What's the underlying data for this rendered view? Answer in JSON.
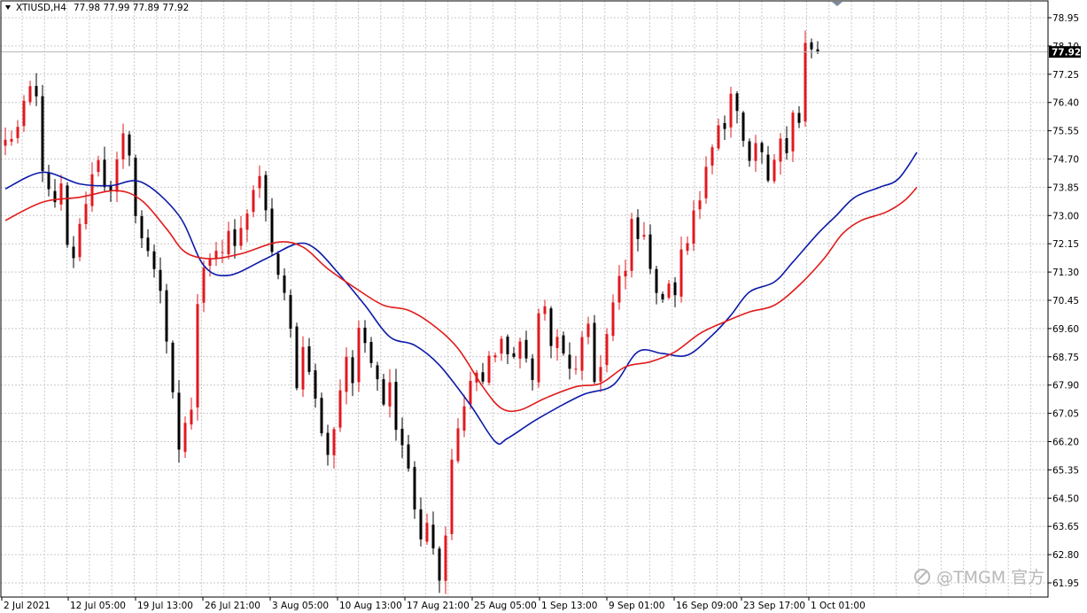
{
  "header": {
    "symbol": "XTIUSD,H4",
    "ohlc": "77.98 77.99 77.89 77.92"
  },
  "watermark": "@TMGM 官方",
  "current_price": "77.92",
  "colors": {
    "bull": "#e0191f",
    "bear": "#000000",
    "ma_fast": "#0c1aa8",
    "ma_slow": "#e01b1b",
    "grid": "#c9c9c9",
    "price_label_bg": "#000000"
  },
  "chart_data": {
    "type": "candlestick",
    "title": "",
    "xlabel": "",
    "ylabel": "",
    "ylim": [
      61.6,
      79.3
    ],
    "y_ticks": [
      "78.95",
      "78.10",
      "77.25",
      "76.40",
      "75.55",
      "74.70",
      "73.85",
      "73.00",
      "72.15",
      "71.30",
      "70.45",
      "69.60",
      "68.75",
      "67.90",
      "67.05",
      "66.20",
      "65.35",
      "64.50",
      "63.65",
      "62.80",
      "61.95"
    ],
    "x_ticks": [
      "2 Jul 2021",
      "12 Jul 05:00",
      "19 Jul 13:00",
      "26 Jul 21:00",
      "3 Aug 05:00",
      "10 Aug 13:00",
      "17 Aug 21:00",
      "25 Aug 05:00",
      "1 Sep 13:00",
      "9 Sep 01:00",
      "16 Sep 09:00",
      "23 Sep 17:00",
      "1 Oct 01:00"
    ],
    "grid": true,
    "close_path": [
      [
        0,
        75.2
      ],
      [
        2,
        75.6
      ],
      [
        4,
        76.8
      ],
      [
        5,
        76.5
      ],
      [
        6,
        74.5
      ],
      [
        7,
        73.6
      ],
      [
        8,
        73.3
      ],
      [
        9,
        73.8
      ],
      [
        10,
        72.0
      ],
      [
        11,
        71.8
      ],
      [
        12,
        72.6
      ],
      [
        13,
        73.5
      ],
      [
        14,
        74.2
      ],
      [
        15,
        74.8
      ],
      [
        16,
        74.0
      ],
      [
        17,
        73.6
      ],
      [
        18,
        74.5
      ],
      [
        19,
        75.3
      ],
      [
        20,
        75.0
      ],
      [
        21,
        73.0
      ],
      [
        22,
        72.2
      ],
      [
        23,
        72.0
      ],
      [
        24,
        71.5
      ],
      [
        25,
        70.8
      ],
      [
        26,
        69.0
      ],
      [
        27,
        67.5
      ],
      [
        28,
        66.0
      ],
      [
        29,
        66.8
      ],
      [
        30,
        67.0
      ],
      [
        31,
        70.5
      ],
      [
        32,
        71.6
      ],
      [
        33,
        71.8
      ],
      [
        34,
        72.0
      ],
      [
        35,
        71.9
      ],
      [
        36,
        72.3
      ],
      [
        37,
        72.1
      ],
      [
        38,
        72.5
      ],
      [
        39,
        73.2
      ],
      [
        40,
        73.8
      ],
      [
        41,
        74.0
      ],
      [
        42,
        73.0
      ],
      [
        43,
        72.0
      ],
      [
        44,
        71.2
      ],
      [
        45,
        70.5
      ],
      [
        46,
        69.5
      ],
      [
        47,
        68.0
      ],
      [
        48,
        69.0
      ],
      [
        49,
        68.5
      ],
      [
        50,
        67.4
      ],
      [
        51,
        66.5
      ],
      [
        52,
        65.7
      ],
      [
        53,
        66.7
      ],
      [
        54,
        67.8
      ],
      [
        55,
        68.8
      ],
      [
        56,
        68.0
      ],
      [
        57,
        69.4
      ],
      [
        58,
        69.2
      ],
      [
        59,
        68.8
      ],
      [
        60,
        68.2
      ],
      [
        61,
        67.5
      ],
      [
        62,
        67.9
      ],
      [
        63,
        66.8
      ],
      [
        64,
        66.2
      ],
      [
        65,
        65.5
      ],
      [
        66,
        64.2
      ],
      [
        67,
        63.4
      ],
      [
        68,
        63.6
      ],
      [
        69,
        63.0
      ],
      [
        70,
        62.0
      ],
      [
        71,
        63.2
      ],
      [
        72,
        65.6
      ],
      [
        73,
        66.5
      ],
      [
        74,
        67.5
      ],
      [
        75,
        68.0
      ],
      [
        76,
        68.3
      ],
      [
        77,
        68.0
      ],
      [
        78,
        68.7
      ],
      [
        79,
        68.9
      ],
      [
        80,
        69.3
      ],
      [
        81,
        68.6
      ],
      [
        82,
        68.9
      ],
      [
        83,
        69.2
      ],
      [
        84,
        68.5
      ],
      [
        85,
        68.0
      ],
      [
        86,
        70.3
      ],
      [
        87,
        70.2
      ],
      [
        88,
        69.0
      ],
      [
        89,
        69.4
      ],
      [
        90,
        68.7
      ],
      [
        91,
        68.3
      ],
      [
        92,
        68.5
      ],
      [
        93,
        69.2
      ],
      [
        94,
        69.5
      ],
      [
        95,
        68.0
      ],
      [
        96,
        68.6
      ],
      [
        97,
        69.4
      ],
      [
        98,
        70.3
      ],
      [
        99,
        71.0
      ],
      [
        100,
        71.3
      ],
      [
        101,
        72.8
      ],
      [
        102,
        72.5
      ],
      [
        103,
        72.2
      ],
      [
        104,
        71.6
      ],
      [
        105,
        70.8
      ],
      [
        106,
        70.5
      ],
      [
        107,
        70.8
      ],
      [
        108,
        70.7
      ],
      [
        109,
        71.8
      ],
      [
        110,
        72.3
      ],
      [
        111,
        73.0
      ],
      [
        112,
        73.5
      ],
      [
        113,
        74.5
      ],
      [
        114,
        75.3
      ],
      [
        115,
        75.8
      ],
      [
        116,
        75.5
      ],
      [
        117,
        76.5
      ],
      [
        118,
        76.0
      ],
      [
        119,
        75.0
      ],
      [
        120,
        74.6
      ],
      [
        121,
        75.0
      ],
      [
        122,
        75.0
      ],
      [
        123,
        74.3
      ],
      [
        124,
        74.8
      ],
      [
        125,
        75.3
      ],
      [
        126,
        74.8
      ],
      [
        127,
        76.0
      ],
      [
        128,
        75.7
      ],
      [
        129,
        78.2
      ],
      [
        130,
        78.0
      ],
      [
        131,
        77.92
      ]
    ],
    "series": [
      {
        "type": "moving-average",
        "color": "#0c1aa8",
        "points": [
          [
            0,
            73.8
          ],
          [
            6,
            74.3
          ],
          [
            12,
            73.95
          ],
          [
            17,
            73.9
          ],
          [
            22,
            74.0
          ],
          [
            28,
            73.0
          ],
          [
            32,
            71.5
          ],
          [
            36,
            71.2
          ],
          [
            42,
            71.7
          ],
          [
            47,
            72.15
          ],
          [
            50,
            72.0
          ],
          [
            54,
            71.2
          ],
          [
            58,
            70.3
          ],
          [
            62,
            69.35
          ],
          [
            66,
            69.1
          ],
          [
            70,
            68.5
          ],
          [
            75,
            67.3
          ],
          [
            79,
            66.2
          ],
          [
            81,
            66.3
          ],
          [
            86,
            66.9
          ],
          [
            93,
            67.6
          ],
          [
            98,
            67.9
          ],
          [
            102,
            68.9
          ],
          [
            106,
            68.85
          ],
          [
            110,
            68.8
          ],
          [
            114,
            69.4
          ],
          [
            117,
            70.0
          ],
          [
            120,
            70.7
          ],
          [
            124,
            71.0
          ],
          [
            127,
            71.6
          ],
          [
            131,
            72.45
          ],
          [
            134,
            73.0
          ],
          [
            137,
            73.55
          ],
          [
            141,
            73.85
          ],
          [
            144,
            74.1
          ],
          [
            147,
            74.9
          ]
        ]
      },
      {
        "type": "moving-average",
        "color": "#e01b1b",
        "points": [
          [
            0,
            72.85
          ],
          [
            6,
            73.4
          ],
          [
            12,
            73.55
          ],
          [
            18,
            73.75
          ],
          [
            22,
            73.45
          ],
          [
            26,
            72.6
          ],
          [
            29,
            71.9
          ],
          [
            33,
            71.7
          ],
          [
            38,
            71.85
          ],
          [
            44,
            72.2
          ],
          [
            48,
            72.05
          ],
          [
            52,
            71.4
          ],
          [
            57,
            70.75
          ],
          [
            61,
            70.3
          ],
          [
            65,
            70.15
          ],
          [
            69,
            69.7
          ],
          [
            73,
            69.0
          ],
          [
            77,
            67.85
          ],
          [
            80,
            67.2
          ],
          [
            83,
            67.15
          ],
          [
            87,
            67.5
          ],
          [
            92,
            67.85
          ],
          [
            96,
            67.95
          ],
          [
            100,
            68.45
          ],
          [
            104,
            68.6
          ],
          [
            108,
            68.9
          ],
          [
            112,
            69.45
          ],
          [
            116,
            69.8
          ],
          [
            120,
            70.1
          ],
          [
            124,
            70.3
          ],
          [
            128,
            70.9
          ],
          [
            132,
            71.7
          ],
          [
            135,
            72.45
          ],
          [
            138,
            72.85
          ],
          [
            142,
            73.1
          ],
          [
            145,
            73.45
          ],
          [
            147,
            73.85
          ]
        ]
      }
    ]
  }
}
